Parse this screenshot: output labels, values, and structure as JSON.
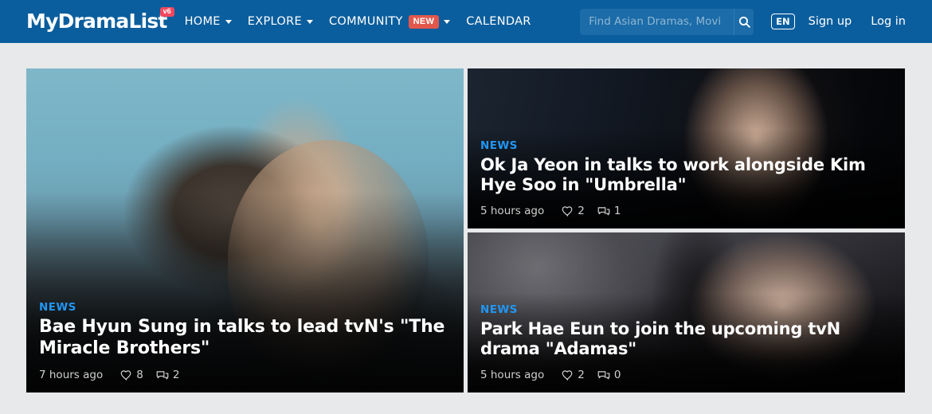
{
  "header": {
    "logo": {
      "text": "MyDramaList",
      "version_badge": "v6"
    },
    "nav": [
      {
        "label": "HOME",
        "has_dropdown": true,
        "badge": null
      },
      {
        "label": "EXPLORE",
        "has_dropdown": true,
        "badge": null
      },
      {
        "label": "COMMUNITY",
        "has_dropdown": true,
        "badge": "NEW"
      },
      {
        "label": "CALENDAR",
        "has_dropdown": false,
        "badge": null
      }
    ],
    "search": {
      "placeholder": "Find Asian Dramas, Movi",
      "value": "",
      "icon": "search-icon"
    },
    "language_badge": "EN",
    "signup_label": "Sign up",
    "login_label": "Log in",
    "background_color": "#0b5e9d",
    "search_background_color": "#1b6ca8",
    "new_badge_color": "#e2574c",
    "version_badge_color": "#f4485e"
  },
  "page": {
    "background_color": "#e7e9eb",
    "kicker_color": "#2196f3"
  },
  "features": {
    "hero": {
      "kicker": "NEWS",
      "title": "Bae Hyun Sung in talks to lead tvN's \"The Miracle Brothers\"",
      "time": "7 hours ago",
      "likes": "8",
      "comments": "2"
    },
    "secondary": [
      {
        "kicker": "NEWS",
        "title": "Ok Ja Yeon in talks to work alongside Kim Hye Soo in \"Umbrella\"",
        "time": "5 hours ago",
        "likes": "2",
        "comments": "1"
      },
      {
        "kicker": "NEWS",
        "title": "Park Hae Eun to join the upcoming tvN drama \"Adamas\"",
        "time": "5 hours ago",
        "likes": "2",
        "comments": "0"
      }
    ]
  }
}
